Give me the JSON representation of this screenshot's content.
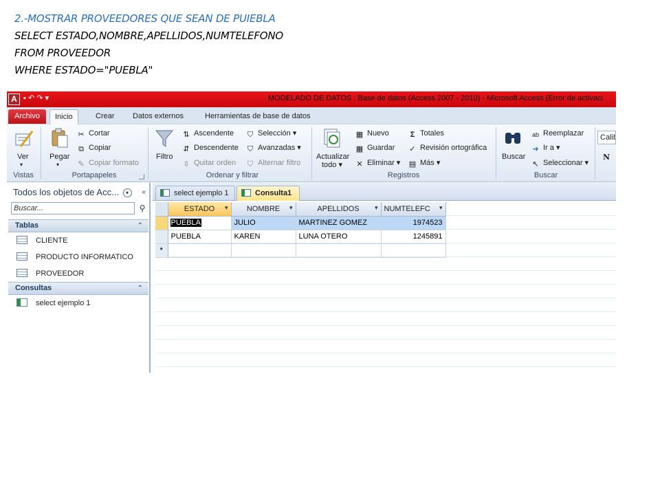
{
  "heading": {
    "title": "2.-MOSTRAR PROVEEDORES QUE SEAN DE PUIEBLA",
    "sql_lines": [
      "SELECT ESTADO,NOMBRE,APELLIDOS,NUMTELEFONO",
      "FROM PROVEEDOR",
      "WHERE ESTADO=\"PUEBLA\""
    ]
  },
  "window": {
    "app_icon": "A",
    "title": "MODELADO DE DATOS : Base de datos (Access 2007 - 2010)  -  Microsoft Access (Error de activaci"
  },
  "tabs": {
    "file": "Archivo",
    "items": [
      "Inicio",
      "Crear",
      "Datos externos",
      "Herramientas de base de datos"
    ]
  },
  "ribbon": {
    "vistas": {
      "ver": "Ver",
      "label": "Vistas"
    },
    "portapapeles": {
      "pegar": "Pegar",
      "cortar": "Cortar",
      "copiar": "Copiar",
      "copiar_formato": "Copiar formato",
      "label": "Portapapeles"
    },
    "ordenar": {
      "filtro": "Filtro",
      "ascendente": "Ascendente",
      "descendente": "Descendente",
      "quitar_orden": "Quitar orden",
      "seleccion": "Selección",
      "avanzadas": "Avanzadas",
      "alternar_filtro": "Alternar filtro",
      "label": "Ordenar y filtrar"
    },
    "registros": {
      "actualizar": "Actualizar",
      "todo": "todo",
      "nuevo": "Nuevo",
      "guardar": "Guardar",
      "eliminar": "Eliminar",
      "totales": "Totales",
      "revision": "Revisión ortográfica",
      "mas": "Más",
      "label": "Registros"
    },
    "buscar": {
      "buscar": "Buscar",
      "reemplazar": "Reemplazar",
      "ir_a": "Ir a",
      "seleccionar": "Seleccionar",
      "label": "Buscar"
    },
    "font": {
      "name": "Calib",
      "bold": "N"
    }
  },
  "nav": {
    "header": "Todos los objetos de Acc...",
    "search_placeholder": "Buscar...",
    "sections": [
      {
        "label": "Tablas",
        "items": [
          "CLIENTE",
          "PRODUCTO INFORMATICO",
          "PROVEEDOR"
        ]
      },
      {
        "label": "Consultas",
        "items": [
          "select ejemplo 1"
        ]
      }
    ]
  },
  "doc_tabs": [
    "select ejemplo 1",
    "Consulta1"
  ],
  "datasheet": {
    "columns": [
      "ESTADO",
      "NOMBRE",
      "APELLIDOS",
      "NUMTELEFC"
    ],
    "rows": [
      [
        "PUEBLA",
        "JULIO",
        "MARTINEZ GOMEZ",
        "1974523"
      ],
      [
        "PUEBLA",
        "KAREN",
        "LUNA OTERO",
        "1245891"
      ]
    ],
    "new_row_marker": "*"
  },
  "colors": {
    "title_text": "#2a6fb5",
    "titlebar": "#d40e13",
    "active_row": "#bcd8f5"
  }
}
